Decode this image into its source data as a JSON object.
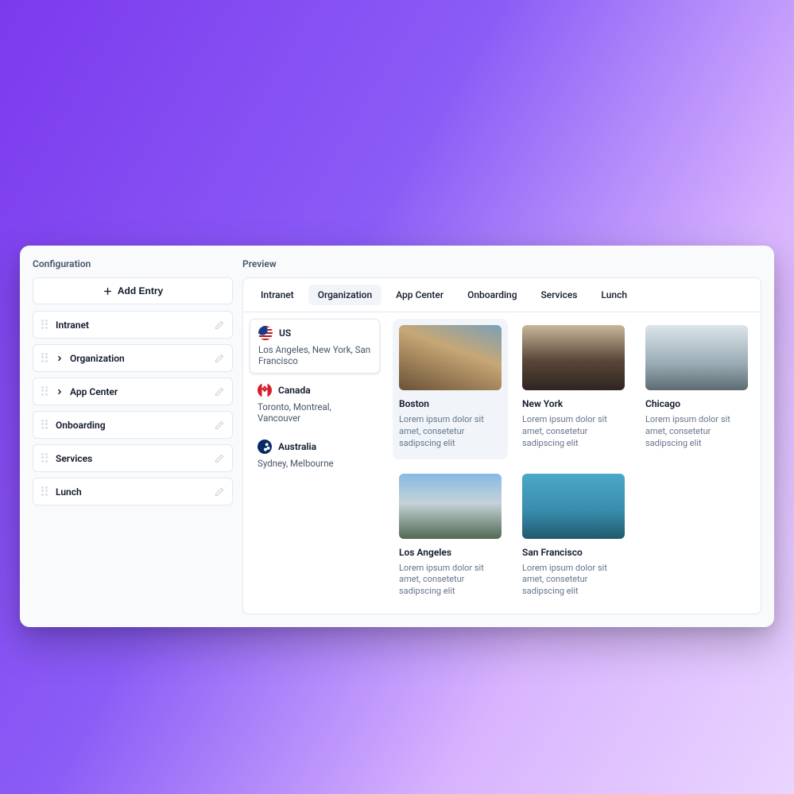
{
  "config": {
    "header": "Configuration",
    "add_button": "Add Entry",
    "items": [
      {
        "label": "Intranet",
        "hasChevron": false
      },
      {
        "label": "Organization",
        "hasChevron": true
      },
      {
        "label": "App Center",
        "hasChevron": true
      },
      {
        "label": "Onboarding",
        "hasChevron": false
      },
      {
        "label": "Services",
        "hasChevron": false
      },
      {
        "label": "Lunch",
        "hasChevron": false
      }
    ]
  },
  "preview": {
    "header": "Preview",
    "tabs": [
      {
        "label": "Intranet"
      },
      {
        "label": "Organization",
        "active": true
      },
      {
        "label": "App Center"
      },
      {
        "label": "Onboarding"
      },
      {
        "label": "Services"
      },
      {
        "label": "Lunch"
      }
    ],
    "countries": [
      {
        "name": "US",
        "subtitle": "Los Angeles, New York, San Francisco",
        "active": true
      },
      {
        "name": "Canada",
        "subtitle": "Toronto, Montreal, Vancouver"
      },
      {
        "name": "Australia",
        "subtitle": "Sydney, Melbourne"
      }
    ],
    "cities": [
      {
        "name": "Boston",
        "desc": "Lorem ipsum dolor sit amet, consetetur sadipscing elit",
        "highlight": true
      },
      {
        "name": "New York",
        "desc": "Lorem ipsum dolor sit amet, consetetur sadipscing elit"
      },
      {
        "name": "Chicago",
        "desc": "Lorem ipsum dolor sit amet, consetetur sadipscing elit"
      },
      {
        "name": "Los Angeles",
        "desc": "Lorem ipsum dolor sit amet, consetetur sadipscing elit"
      },
      {
        "name": "San Francisco",
        "desc": "Lorem ipsum dolor sit amet, consetetur sadipscing elit"
      }
    ]
  }
}
